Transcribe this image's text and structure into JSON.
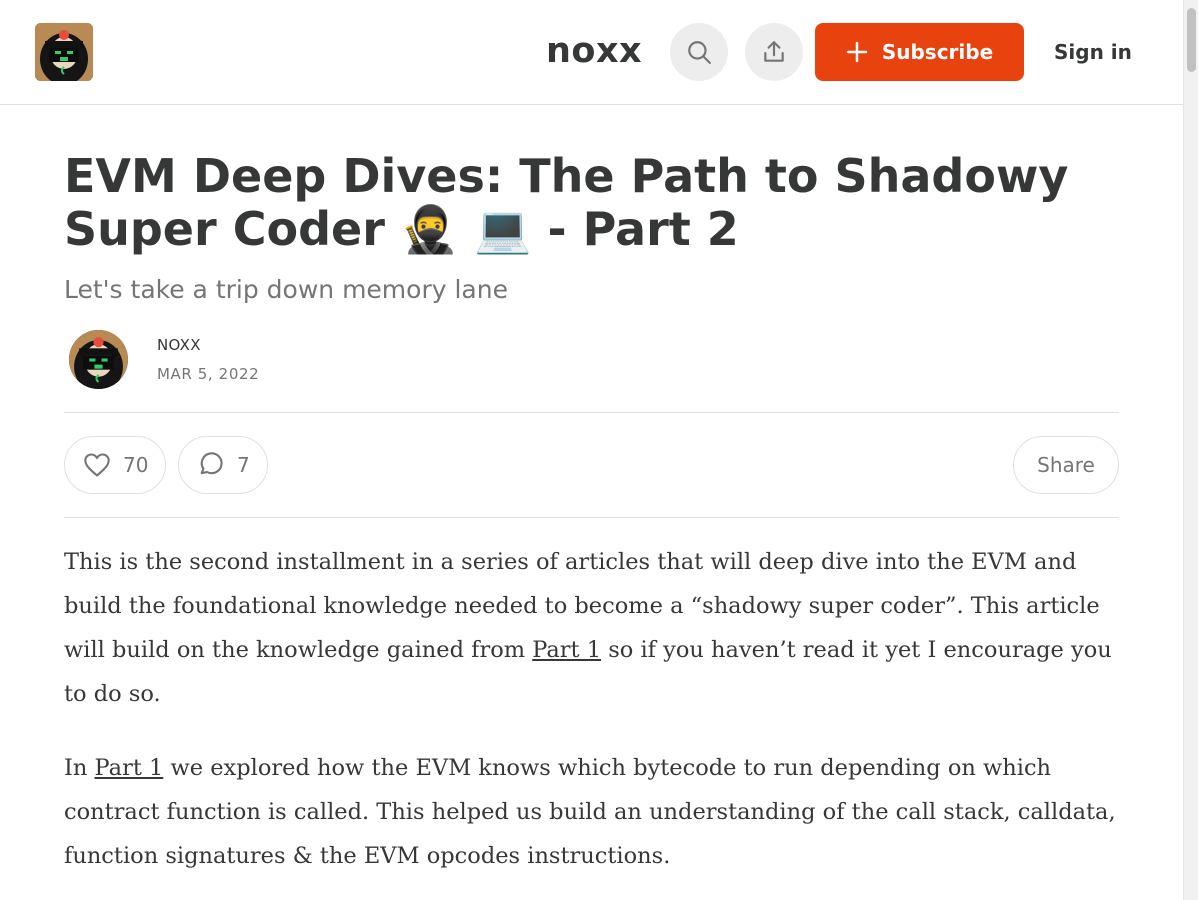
{
  "header": {
    "publication_name": "noxx",
    "subscribe_label": "Subscribe",
    "signin_label": "Sign in",
    "accent_color": "#e8430f"
  },
  "article": {
    "title": "EVM Deep Dives: The Path to Shadowy Super Coder 🥷 💻 - Part 2",
    "subtitle": "Let's take a trip down memory lane",
    "author": "NOXX",
    "date": "MAR 5, 2022",
    "likes": "70",
    "comments": "7",
    "share_label": "Share",
    "paragraph1": {
      "before": "This is the second installment in a series of articles that will deep dive into the EVM and build the foundational knowledge needed to become a “shadowy super coder”. This article will build on the knowledge gained from ",
      "link": "Part 1",
      "after": " so if you haven’t read it yet I encourage you to do so."
    },
    "paragraph2": {
      "before": "In ",
      "link": "Part 1",
      "after": " we explored how the EVM knows which bytecode to run depending on which contract function is called. This helped us build an understanding of the call stack, calldata, function signatures & the EVM opcodes instructions."
    }
  },
  "icons": {
    "search": "search-icon",
    "share": "share-icon",
    "plus": "plus-icon",
    "heart": "heart-icon",
    "comment": "comment-icon"
  }
}
